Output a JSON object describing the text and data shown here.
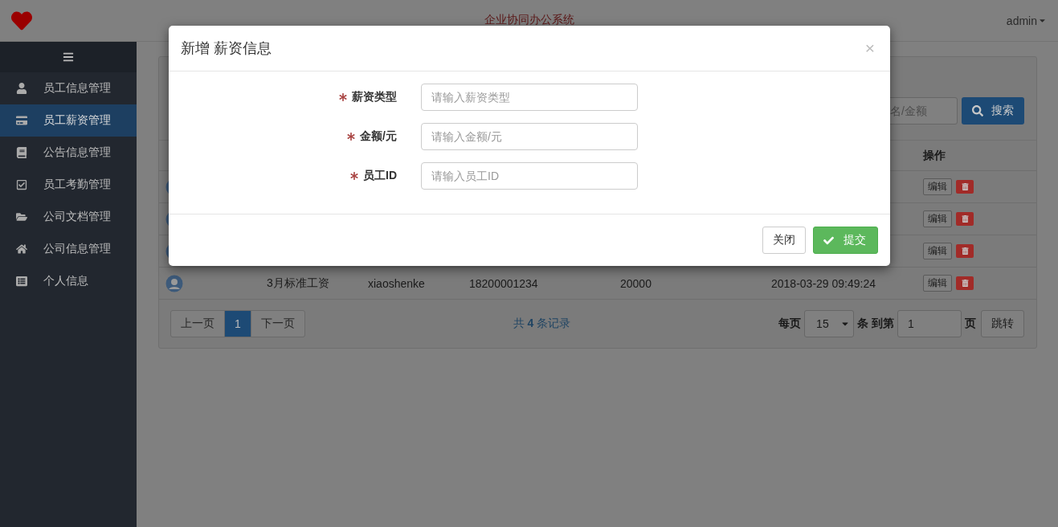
{
  "header": {
    "title": "企业协同办公系统",
    "user": "admin"
  },
  "sidebar": {
    "items": [
      {
        "label": "员工信息管理",
        "selected": false
      },
      {
        "label": "员工薪资管理",
        "selected": true
      },
      {
        "label": "公告信息管理",
        "selected": false
      },
      {
        "label": "员工考勤管理",
        "selected": false
      },
      {
        "label": "公司文档管理",
        "selected": false
      },
      {
        "label": "公司信息管理",
        "selected": false
      },
      {
        "label": "个人信息",
        "selected": false
      }
    ]
  },
  "search": {
    "placeholder": "名/金额",
    "button": "搜索"
  },
  "table": {
    "action_header": "操作",
    "rows": [
      {
        "edit": "编辑"
      },
      {
        "edit": "编辑"
      },
      {
        "edit": "编辑"
      },
      {
        "salary_type": "3月标准工资",
        "username": "xiaoshenke",
        "phone": "18200001234",
        "amount": "20000",
        "time": "2018-03-29 09:49:24",
        "edit": "编辑"
      }
    ]
  },
  "pagination": {
    "prev": "上一页",
    "pages": [
      {
        "label": "1",
        "selected": true
      }
    ],
    "next": "下一页",
    "summary": "共 **4** 条记录",
    "per_page_label": "每页",
    "per_page": "15",
    "goto_label": "条 到第",
    "page_input": "1",
    "page_unit": "页",
    "jump": "跳转"
  },
  "modal": {
    "title": "新增 薪资信息",
    "close": "×",
    "fields": [
      {
        "label": "薪资类型",
        "placeholder": "请输入薪资类型",
        "required": true
      },
      {
        "label": "金额/元",
        "placeholder": "请输入金额/元",
        "required": true
      },
      {
        "label": "员工ID",
        "placeholder": "请输入员工ID",
        "required": true
      }
    ],
    "buttons": [
      {
        "label": "关闭",
        "kind": "default"
      },
      {
        "label": "提交",
        "kind": "primary"
      }
    ]
  }
}
